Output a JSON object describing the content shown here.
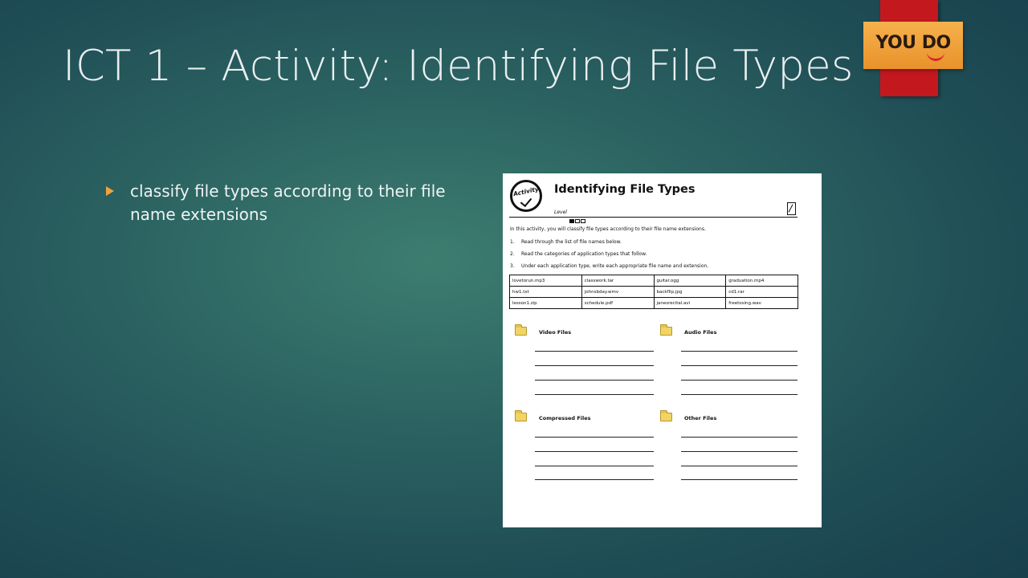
{
  "slide": {
    "title": "ICT 1 – Activity: Identifying File Types",
    "bullet": "classify file types according to their file name extensions"
  },
  "badge": {
    "text": "YOU DO",
    "colors": {
      "stripe": "#c4181f",
      "badge": "#f0a23c"
    }
  },
  "worksheet": {
    "activity_label": "Activity",
    "title": "Identifying File Types",
    "level_label": "Level",
    "level": {
      "filled": 1,
      "total": 3
    },
    "intro": "In this activity, you will classify file types according to their file name extensions.",
    "steps": [
      {
        "num": "1.",
        "text": "Read through the list of file names below."
      },
      {
        "num": "2.",
        "text": "Read the categories of application types that follow."
      },
      {
        "num": "3.",
        "text": "Under each application type, write each appropriate file name and extension."
      }
    ],
    "files": [
      [
        "lovetorun.mp3",
        "classwork.tar",
        "guitar.ogg",
        "graduation.mp4"
      ],
      [
        "hw1.txt",
        "johnsbday.wmv",
        "backflip.jpg",
        "cd1.rar"
      ],
      [
        "lesson1.zip",
        "schedule.pdf",
        "janesrecital.avi",
        "freetosing.wav"
      ]
    ],
    "categories": {
      "video": "Video Files",
      "audio": "Audio Files",
      "compressed": "Compressed Files",
      "other": "Other Files"
    }
  }
}
